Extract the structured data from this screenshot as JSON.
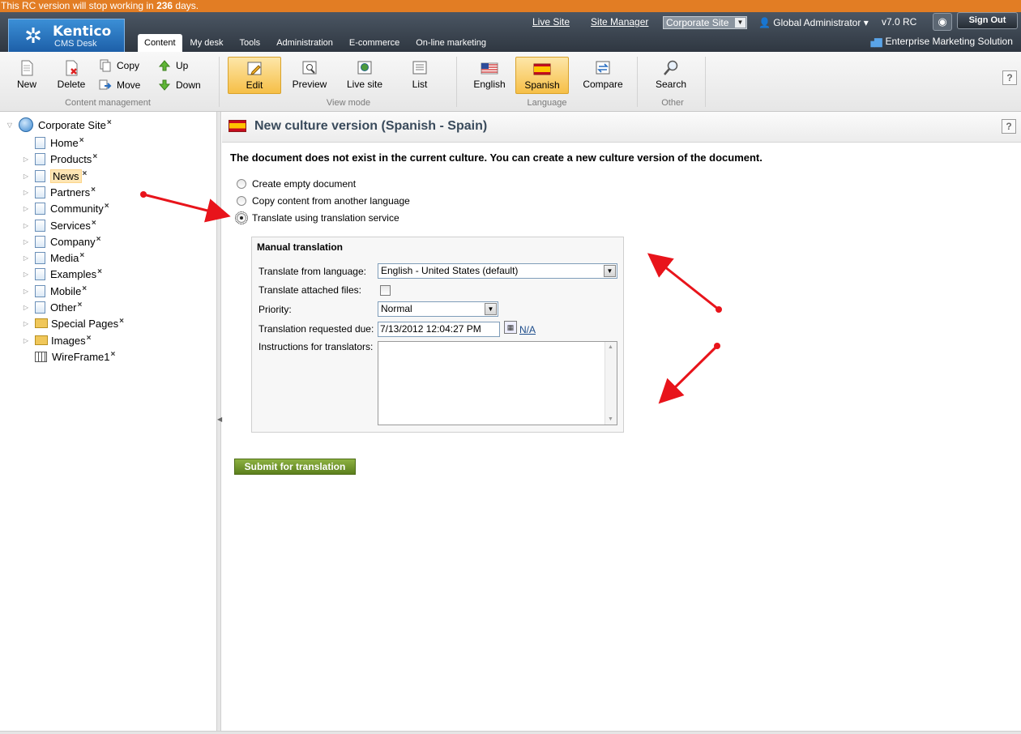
{
  "banner": {
    "prefix": "This RC version will stop working in ",
    "days": "236",
    "suffix": " days."
  },
  "header": {
    "logo_title": "Kentico",
    "logo_sub": "CMS Desk",
    "tabs": [
      {
        "label": "Content",
        "active": true
      },
      {
        "label": "My desk"
      },
      {
        "label": "Tools"
      },
      {
        "label": "Administration"
      },
      {
        "label": "E-commerce"
      },
      {
        "label": "On-line marketing"
      }
    ],
    "links": [
      "Live Site",
      "Site Manager"
    ],
    "site_select": "Corporate Site",
    "user": "Global Administrator",
    "version": "v7.0 RC",
    "signout": "Sign Out",
    "edition": "Enterprise Marketing Solution"
  },
  "toolbar": {
    "new": "New",
    "delete": "Delete",
    "copy": "Copy",
    "move": "Move",
    "up": "Up",
    "down": "Down",
    "group_content": "Content management",
    "edit": "Edit",
    "preview": "Preview",
    "livesite": "Live site",
    "list": "List",
    "group_view": "View mode",
    "english": "English",
    "spanish": "Spanish",
    "compare": "Compare",
    "group_language": "Language",
    "search": "Search",
    "group_other": "Other",
    "help": "?"
  },
  "tree": {
    "root": "Corporate Site",
    "items": [
      "Home",
      "Products",
      "News",
      "Partners",
      "Community",
      "Services",
      "Company",
      "Media",
      "Examples",
      "Mobile",
      "Other",
      "Special Pages",
      "Images",
      "WireFrame1"
    ],
    "selected": "News",
    "delete_mark": "×"
  },
  "main": {
    "title": "New culture version (Spanish - Spain)",
    "message": "The document does not exist in the current culture. You can create a new culture version of the document.",
    "options": [
      "Create empty document",
      "Copy content from another language",
      "Translate using translation service"
    ],
    "selected_option": 2,
    "panel": {
      "title": "Manual translation",
      "from_label": "Translate from language:",
      "from_value": "English - United States (default)",
      "attached_label": "Translate attached files:",
      "priority_label": "Priority:",
      "priority_value": "Normal",
      "due_label": "Translation requested due:",
      "due_value": "7/13/2012 12:04:27 PM",
      "due_na": "N/A",
      "instructions_label": "Instructions for translators:",
      "instructions_value": ""
    },
    "submit": "Submit for translation"
  },
  "colors": {
    "accent": "#e27d24",
    "header": "#3a434d",
    "submit": "#6e921f",
    "annotation": "#e8141b"
  }
}
